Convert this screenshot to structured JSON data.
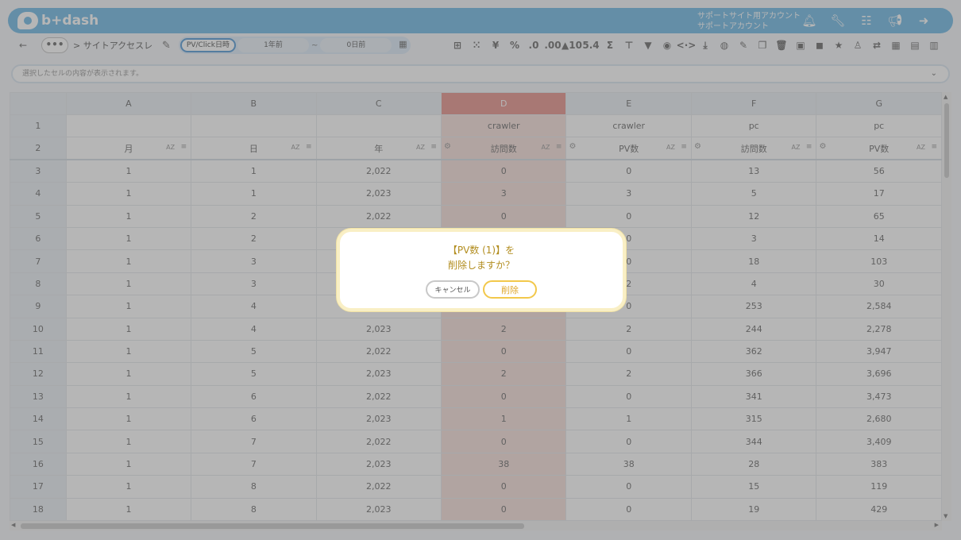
{
  "header": {
    "logo_text": "b+dash",
    "account_line1": "サポートサイト用アカウント",
    "account_line2": "サポートアカウント",
    "icons": [
      "bell-icon",
      "wrench-icon",
      "grid-icon",
      "megaphone-icon",
      "logout-icon"
    ]
  },
  "toolbar": {
    "back": "←",
    "more": "•••",
    "breadcrumb": "> サイトアクセスレ…",
    "range_type": "PV/Click日時",
    "range_from": "1年前",
    "range_sep": "~",
    "range_to": "0日前",
    "tool_labels": [
      "⊞",
      "⁙",
      "¥",
      "%",
      ".0",
      ".00",
      "▲10",
      "5.4",
      "Σ",
      "⊤",
      "▼",
      "◉",
      "<·>",
      "⤓",
      "◍",
      "✎",
      "❐",
      "🗑",
      "▣",
      "◼",
      "★",
      "♙",
      "⇄",
      "▦",
      "▤",
      "▥"
    ]
  },
  "formula_bar": {
    "placeholder": "選択したセルの内容が表示されます。",
    "chevron": "⌄"
  },
  "grid": {
    "columns": [
      "A",
      "B",
      "C",
      "D",
      "E",
      "F",
      "G"
    ],
    "group_row": [
      "",
      "",
      "",
      "crawler",
      "crawler",
      "pc",
      "pc"
    ],
    "field_row": [
      "月",
      "日",
      "年",
      "訪問数",
      "PV数",
      "訪問数",
      "PV数"
    ],
    "az_label": "AZ",
    "header_row_numbers": [
      "1",
      "2"
    ],
    "rows": [
      {
        "n": "3",
        "cells": [
          "1",
          "1",
          "2,022",
          "0",
          "0",
          "13",
          "56"
        ]
      },
      {
        "n": "4",
        "cells": [
          "1",
          "1",
          "2,023",
          "3",
          "3",
          "5",
          "17"
        ]
      },
      {
        "n": "5",
        "cells": [
          "1",
          "2",
          "2,022",
          "0",
          "0",
          "12",
          "65"
        ]
      },
      {
        "n": "6",
        "cells": [
          "1",
          "2",
          "",
          "",
          "0",
          "3",
          "14"
        ]
      },
      {
        "n": "7",
        "cells": [
          "1",
          "3",
          "",
          "",
          "0",
          "18",
          "103"
        ]
      },
      {
        "n": "8",
        "cells": [
          "1",
          "3",
          "",
          "",
          "2",
          "4",
          "30"
        ]
      },
      {
        "n": "9",
        "cells": [
          "1",
          "4",
          "",
          "",
          "0",
          "253",
          "2,584"
        ]
      },
      {
        "n": "10",
        "cells": [
          "1",
          "4",
          "2,023",
          "2",
          "2",
          "244",
          "2,278"
        ]
      },
      {
        "n": "11",
        "cells": [
          "1",
          "5",
          "2,022",
          "0",
          "0",
          "362",
          "3,947"
        ]
      },
      {
        "n": "12",
        "cells": [
          "1",
          "5",
          "2,023",
          "2",
          "2",
          "366",
          "3,696"
        ]
      },
      {
        "n": "13",
        "cells": [
          "1",
          "6",
          "2,022",
          "0",
          "0",
          "341",
          "3,473"
        ]
      },
      {
        "n": "14",
        "cells": [
          "1",
          "6",
          "2,023",
          "1",
          "1",
          "315",
          "2,680"
        ]
      },
      {
        "n": "15",
        "cells": [
          "1",
          "7",
          "2,022",
          "0",
          "0",
          "344",
          "3,409"
        ]
      },
      {
        "n": "16",
        "cells": [
          "1",
          "7",
          "2,023",
          "38",
          "38",
          "28",
          "383"
        ]
      },
      {
        "n": "17",
        "cells": [
          "1",
          "8",
          "2,022",
          "0",
          "0",
          "15",
          "119"
        ]
      },
      {
        "n": "18",
        "cells": [
          "1",
          "8",
          "2,023",
          "0",
          "0",
          "19",
          "429"
        ]
      }
    ]
  },
  "dialog": {
    "line1": "【PV数 (1)】を",
    "line2": "削除しますか？",
    "cancel_label": "キャンセル",
    "delete_label": "削除"
  },
  "colors": {
    "header_bg": "#5aaee0",
    "highlight_col": "#e2837a",
    "dialog_text": "#b28d1f",
    "delete_button": "#f2c84b"
  }
}
